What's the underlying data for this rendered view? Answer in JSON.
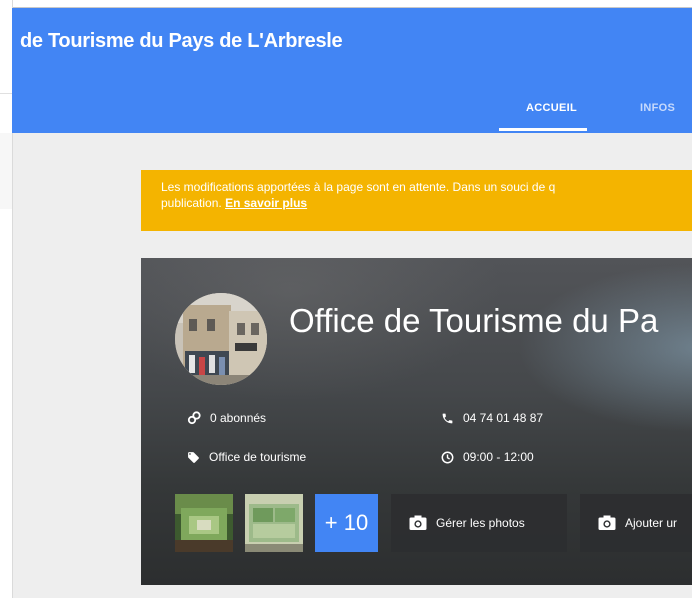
{
  "header": {
    "title": "de Tourisme du Pays de L'Arbresle",
    "tabs": [
      {
        "label": "ACCUEIL",
        "active": true
      },
      {
        "label": "INFOS",
        "active": false
      }
    ],
    "color": "#4285f4"
  },
  "banner": {
    "text": "Les modifications apportées à la page sont en attente. Dans un souci de q",
    "text2": "publication.",
    "link": "En savoir plus",
    "color": "#f4b400"
  },
  "business": {
    "name": "Office de Tourisme du Pa",
    "followers": "0 abonnés",
    "phone": "04 74 01 48 87",
    "category": "Office de tourisme",
    "hours": "09:00 - 12:00",
    "more_photos": "+ 10",
    "manage_photos": "Gérer les photos",
    "add_photo": "Ajouter ur"
  },
  "icons": {
    "followers": "link-people-icon",
    "phone": "phone-icon",
    "category": "tag-icon",
    "hours": "clock-icon",
    "camera": "camera-icon"
  }
}
